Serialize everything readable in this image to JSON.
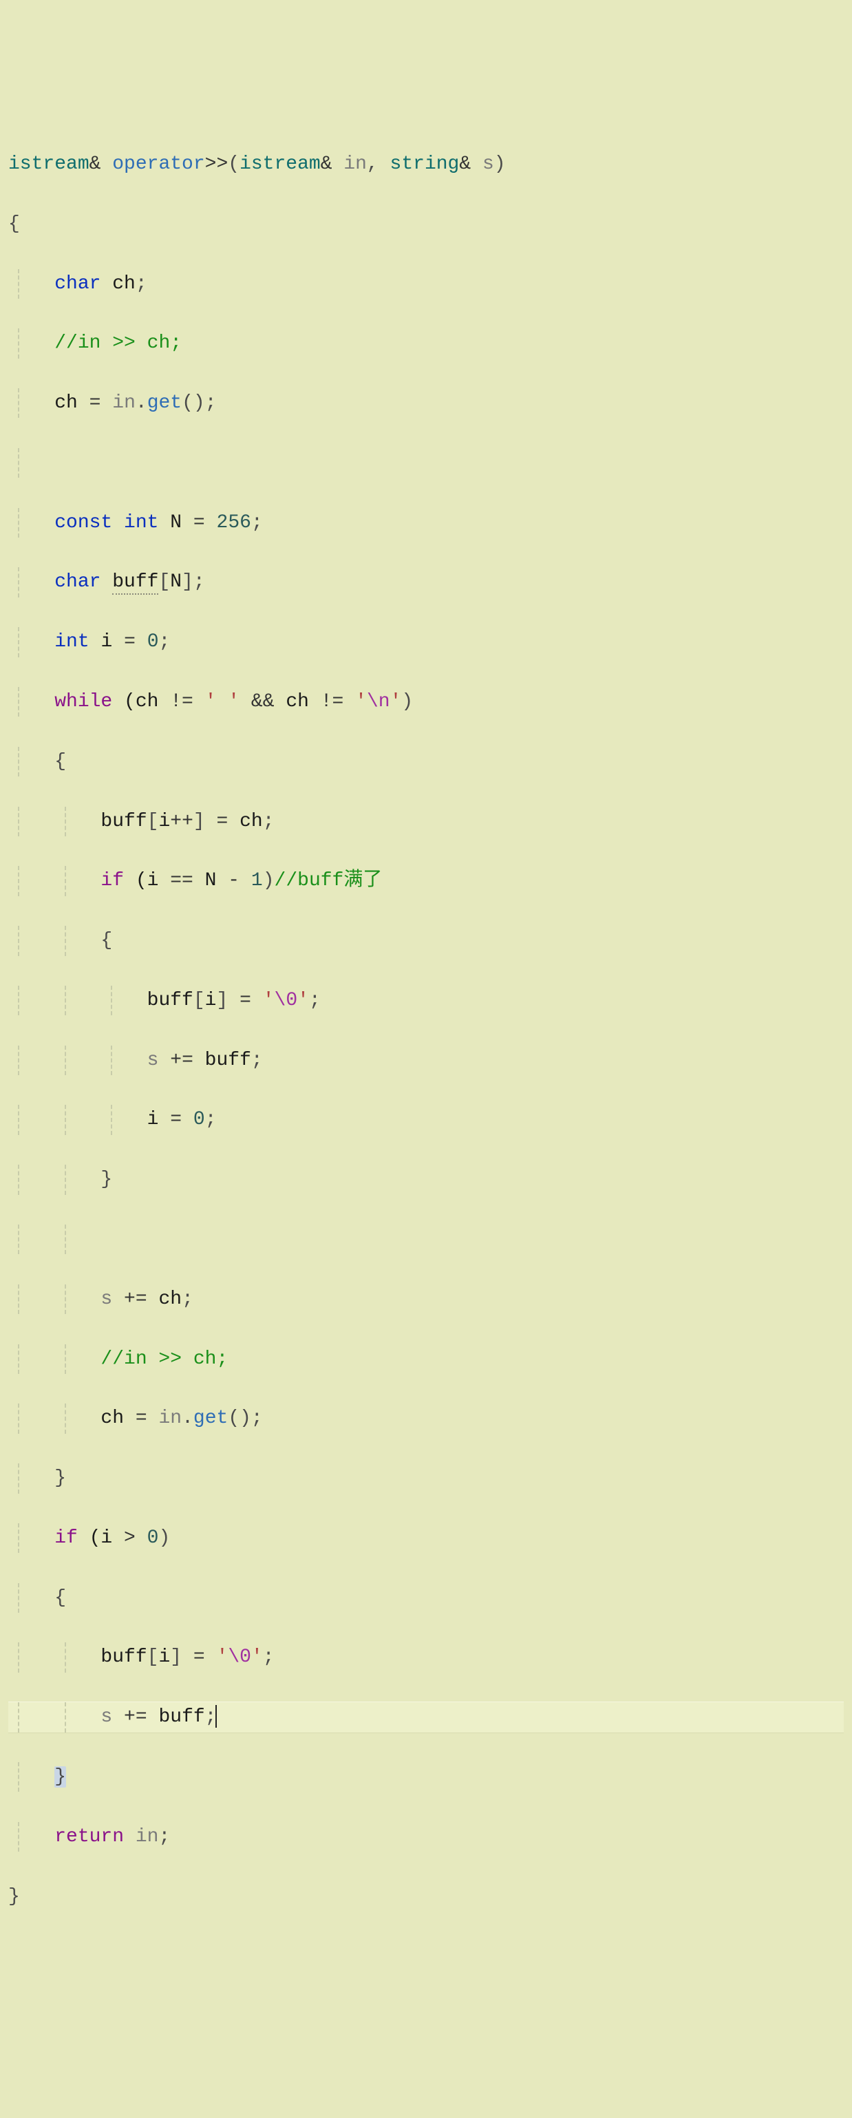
{
  "colors": {
    "background": "#e6e9be",
    "currentLine": "#edf0c9",
    "indentGuide": "#c8ccaa",
    "type": "#0f6d6d",
    "function": "#2e6db5",
    "keyword": "#0a2fbf",
    "keywordControl": "#8a128a",
    "comment": "#1a8f1a",
    "string": "#b04040",
    "escape": "#a030a0",
    "param": "#7a7a7a"
  },
  "editor": {
    "language": "cpp",
    "currentLineIndex": 24,
    "cursorAfter": "s += buff;"
  },
  "code": [
    "istream& operator>>(istream& in, string& s)",
    "{",
    "    char ch;",
    "    //in >> ch;",
    "    ch = in.get();",
    "",
    "    const int N = 256;",
    "    char buff[N];",
    "    int i = 0;",
    "    while (ch != ' ' && ch != '\\n')",
    "    {",
    "        buff[i++] = ch;",
    "        if (i == N - 1)//buff满了",
    "        {",
    "            buff[i] = '\\0';",
    "            s += buff;",
    "            i = 0;",
    "        }",
    "",
    "        s += ch;",
    "        //in >> ch;",
    "        ch = in.get();",
    "    }",
    "    if (i > 0)",
    "    {",
    "        buff[i] = '\\0';",
    "        s += buff;",
    "    }",
    "    return in;",
    "}"
  ],
  "tokens": {
    "l0": {
      "t0": "istream",
      "t1": "& ",
      "t2": "operator",
      "t3": ">>",
      "t4": "(",
      "t5": "istream",
      "t6": "& ",
      "t7": "in",
      "t8": ", ",
      "t9": "string",
      "t10": "& ",
      "t11": "s",
      "t12": ")"
    },
    "l1": {
      "t0": "{"
    },
    "l2": {
      "t0": "char",
      "t1": " ch",
      "t2": ";"
    },
    "l3": {
      "t0": "//in >> ch;"
    },
    "l4": {
      "t0": "ch ",
      "t1": "=",
      "t2": " ",
      "t3": "in",
      "t4": ".",
      "t5": "get",
      "t6": "()",
      "t7": ";"
    },
    "l6": {
      "t0": "const",
      "t1": " ",
      "t2": "int",
      "t3": " N ",
      "t4": "=",
      "t5": " ",
      "t6": "256",
      "t7": ";"
    },
    "l7": {
      "t0": "char",
      "t1": " ",
      "t2": "buff",
      "t3": "[",
      "t4": "N",
      "t5": "]",
      "t6": ";"
    },
    "l8": {
      "t0": "int",
      "t1": " i ",
      "t2": "=",
      "t3": " ",
      "t4": "0",
      "t5": ";"
    },
    "l9": {
      "t0": "while",
      "t1": " (ch ",
      "t2": "!=",
      "t3": " ",
      "t4": "' '",
      "t5": " ",
      "t6": "&&",
      "t7": " ch ",
      "t8": "!=",
      "t9": " ",
      "t10": "'",
      "t11": "\\n",
      "t12": "'",
      "t13": ")"
    },
    "l10": {
      "t0": "{"
    },
    "l11": {
      "t0": "buff",
      "t1": "[",
      "t2": "i",
      "t3": "++",
      "t4": "]",
      "t5": " ",
      "t6": "=",
      "t7": " ch",
      "t8": ";"
    },
    "l12": {
      "t0": "if",
      "t1": " (i ",
      "t2": "==",
      "t3": " N ",
      "t4": "-",
      "t5": " ",
      "t6": "1",
      "t7": ")",
      "t8": "//buff满了"
    },
    "l13": {
      "t0": "{"
    },
    "l14": {
      "t0": "buff",
      "t1": "[",
      "t2": "i",
      "t3": "]",
      "t4": " ",
      "t5": "=",
      "t6": " ",
      "t7": "'",
      "t8": "\\0",
      "t9": "'",
      "t10": ";"
    },
    "l15": {
      "t0": "s",
      "t1": " ",
      "t2": "+=",
      "t3": " buff",
      "t4": ";"
    },
    "l16": {
      "t0": "i ",
      "t1": "=",
      "t2": " ",
      "t3": "0",
      "t4": ";"
    },
    "l17": {
      "t0": "}"
    },
    "l19": {
      "t0": "s",
      "t1": " ",
      "t2": "+=",
      "t3": " ch",
      "t4": ";"
    },
    "l20": {
      "t0": "//in >> ch;"
    },
    "l21": {
      "t0": "ch ",
      "t1": "=",
      "t2": " ",
      "t3": "in",
      "t4": ".",
      "t5": "get",
      "t6": "()",
      "t7": ";"
    },
    "l22": {
      "t0": "}"
    },
    "l23": {
      "t0": "if",
      "t1": " (i ",
      "t2": ">",
      "t3": " ",
      "t4": "0",
      "t5": ")"
    },
    "l24": {
      "t0": "{"
    },
    "l25": {
      "t0": "buff",
      "t1": "[",
      "t2": "i",
      "t3": "]",
      "t4": " ",
      "t5": "=",
      "t6": " ",
      "t7": "'",
      "t8": "\\0",
      "t9": "'",
      "t10": ";"
    },
    "l26": {
      "t0": "s",
      "t1": " ",
      "t2": "+=",
      "t3": " buff",
      "t4": ";"
    },
    "l27": {
      "t0": "}"
    },
    "l28": {
      "t0": "return",
      "t1": " ",
      "t2": "in",
      "t3": ";"
    },
    "l29": {
      "t0": "}"
    }
  }
}
